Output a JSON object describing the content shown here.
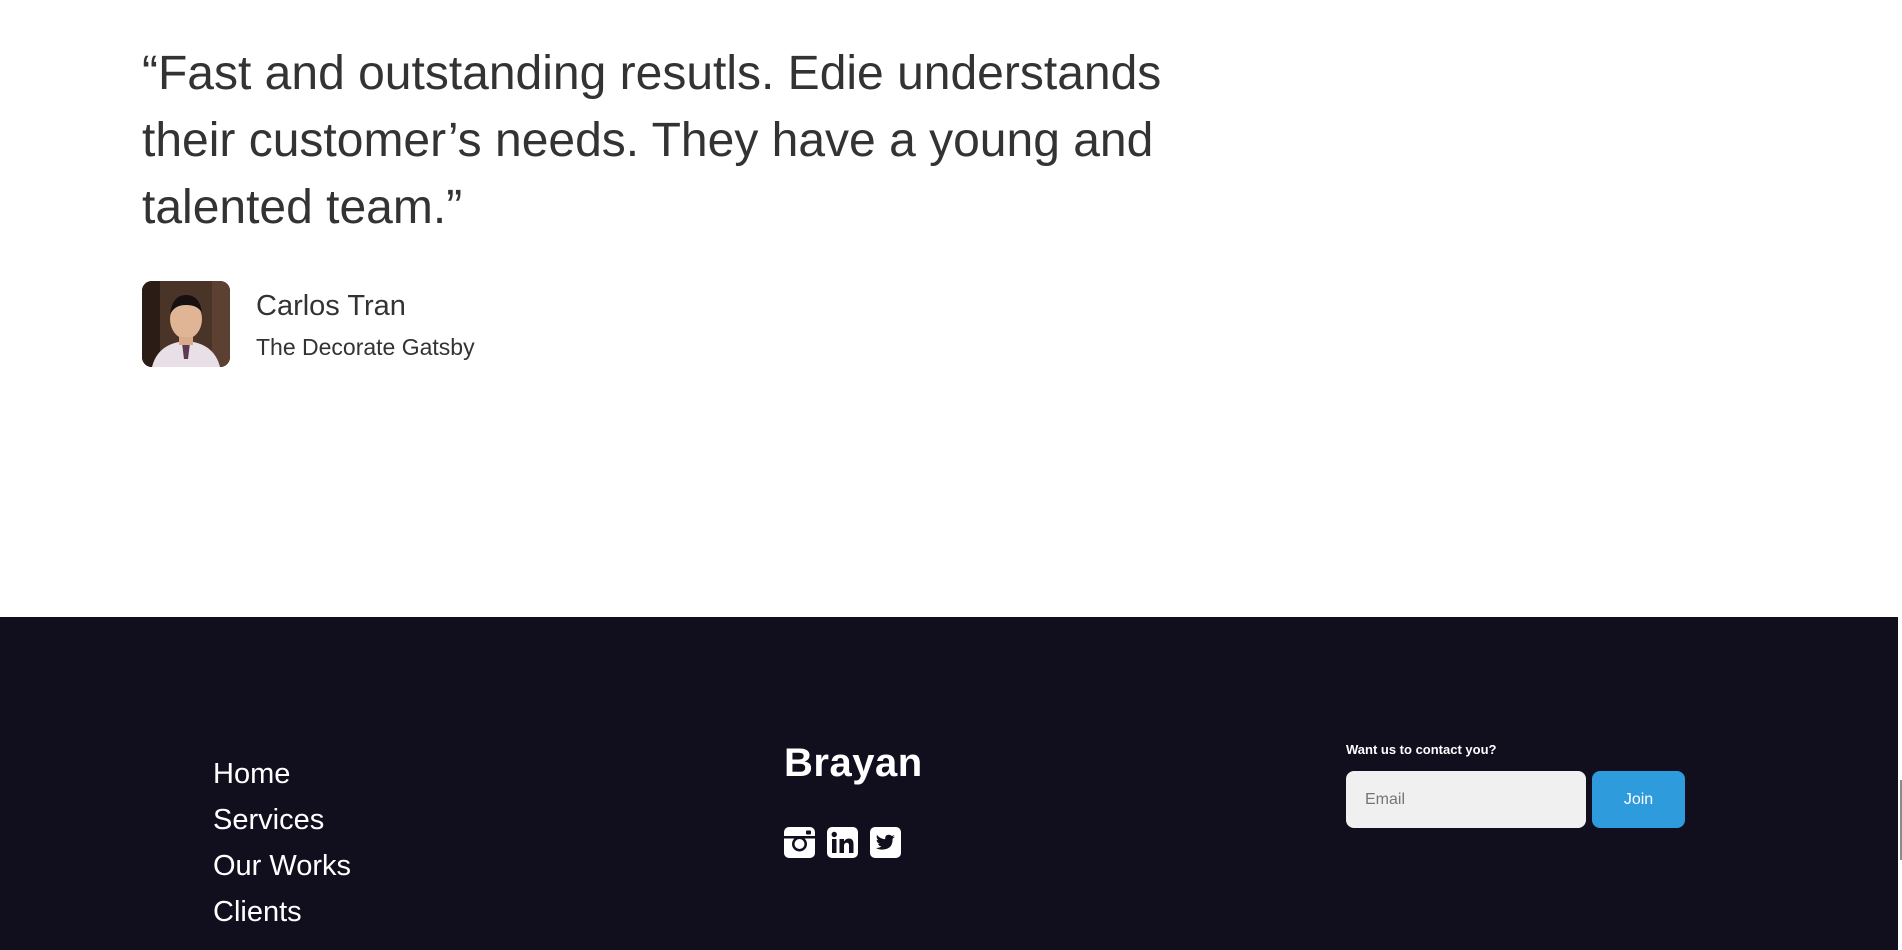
{
  "testimonial": {
    "quote": "“Fast and outstanding resutls. Edie understands their customer’s needs. They have a young and talented team.”",
    "author_name": "Carlos Tran",
    "author_company": "The Decorate Gatsby"
  },
  "footer": {
    "nav": [
      {
        "label": "Home"
      },
      {
        "label": "Services"
      },
      {
        "label": "Our Works"
      },
      {
        "label": "Clients"
      }
    ],
    "brand": "Brayan",
    "socials": [
      {
        "icon": "instagram-icon"
      },
      {
        "icon": "linkedin-icon"
      },
      {
        "icon": "twitter-icon"
      }
    ],
    "contact": {
      "label": "Want us to contact you?",
      "email_placeholder": "Email",
      "join_label": "Join"
    }
  },
  "colors": {
    "footer_bg": "#110f1e",
    "accent": "#2e9bdc",
    "text_dark": "#333333"
  }
}
